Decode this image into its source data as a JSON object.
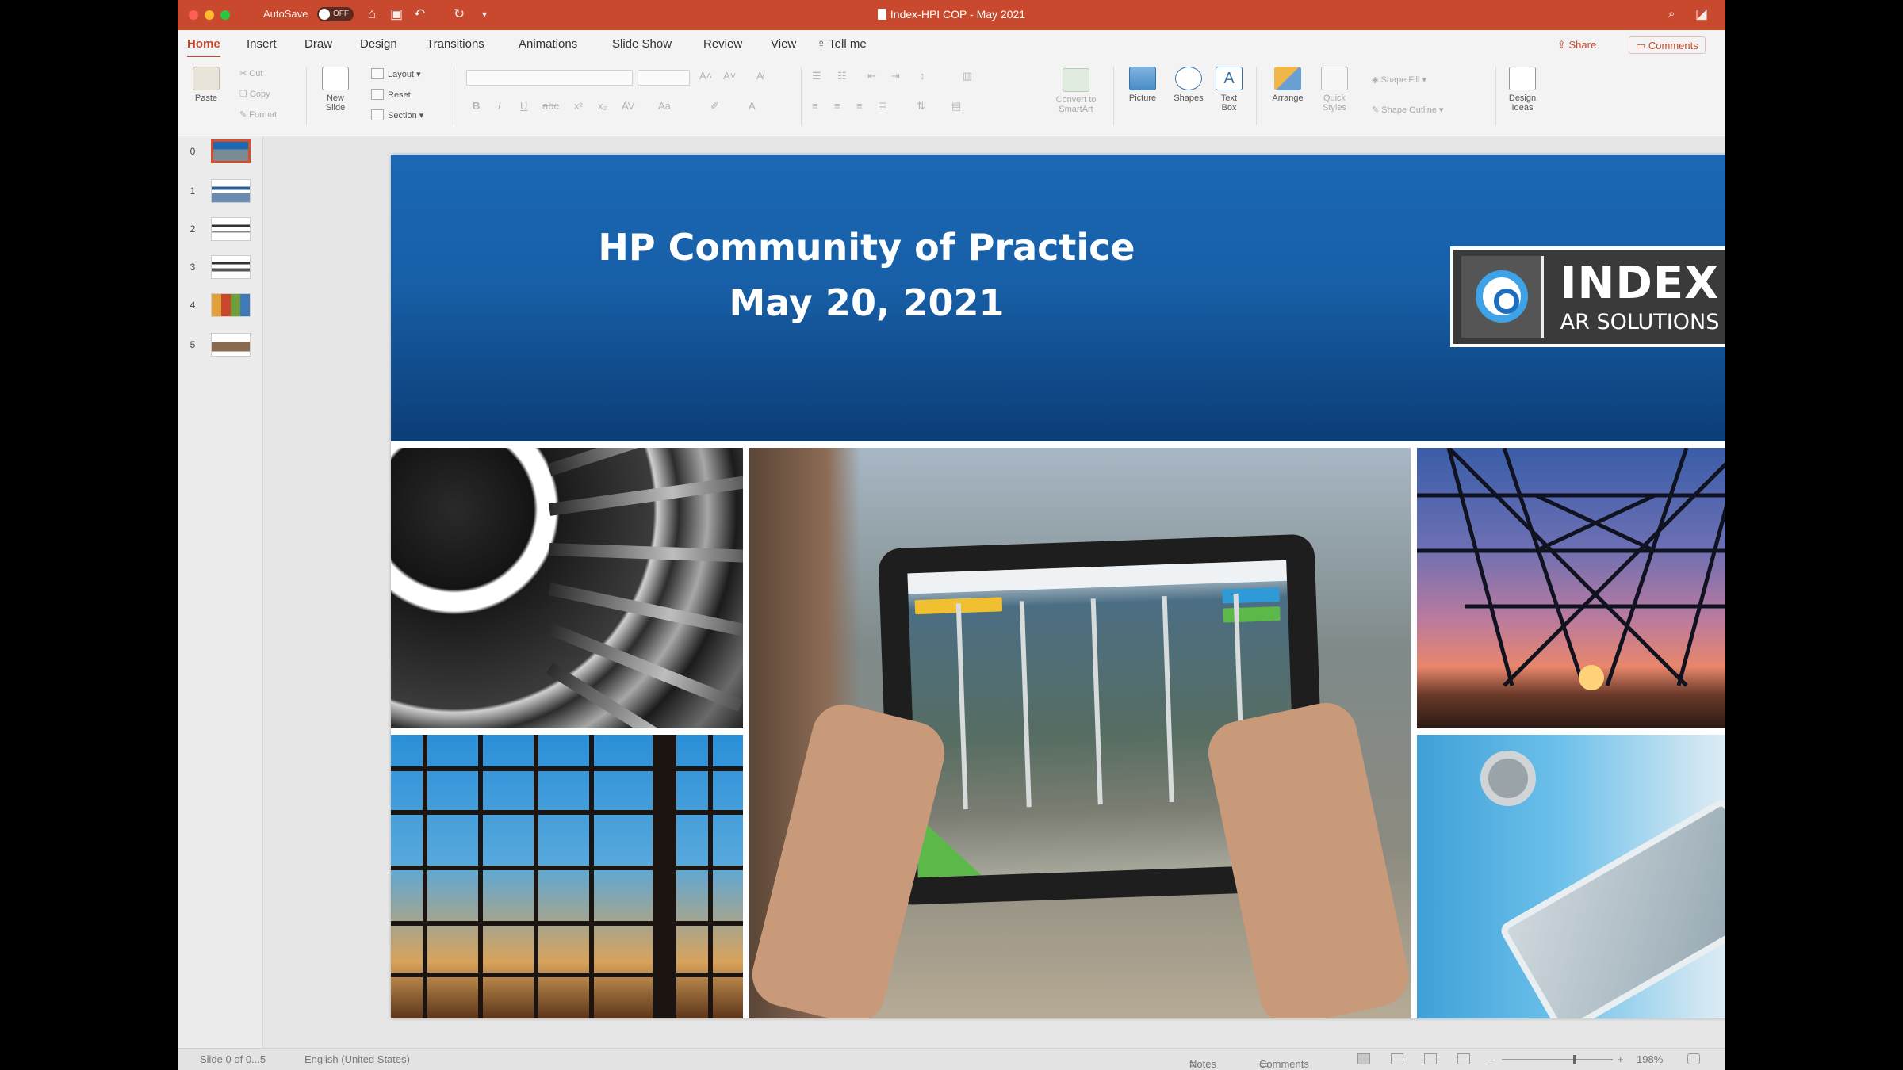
{
  "titlebar": {
    "autosave_label": "AutoSave",
    "autosave_state": "OFF",
    "document_title": "Index-HPI COP - May 2021"
  },
  "tabs": [
    "Home",
    "Insert",
    "Draw",
    "Design",
    "Transitions",
    "Animations",
    "Slide Show",
    "Review",
    "View"
  ],
  "tell_me": "Tell me",
  "share_label": "Share",
  "comments_label": "Comments",
  "ribbon": {
    "paste": "Paste",
    "cut": "Cut",
    "copy": "Copy",
    "format": "Format",
    "new_slide": [
      "New",
      "Slide"
    ],
    "layout": "Layout",
    "reset": "Reset",
    "section": "Section",
    "convert_smartart": [
      "Convert to",
      "SmartArt"
    ],
    "picture": "Picture",
    "shapes": "Shapes",
    "text_box": [
      "Text",
      "Box"
    ],
    "arrange": "Arrange",
    "quick_styles": [
      "Quick",
      "Styles"
    ],
    "shape_fill": "Shape Fill",
    "shape_outline": "Shape Outline",
    "design_ideas": [
      "Design",
      "Ideas"
    ]
  },
  "thumbnails": [
    {
      "num": "0",
      "selected": true
    },
    {
      "num": "1",
      "selected": false
    },
    {
      "num": "2",
      "selected": false
    },
    {
      "num": "3",
      "selected": false
    },
    {
      "num": "4",
      "selected": false
    },
    {
      "num": "5",
      "selected": false
    }
  ],
  "slide": {
    "title_line1": "HP Community of Practice",
    "title_line2": "May 20, 2021",
    "logo_main": "INDEX",
    "logo_sub": "AR SOLUTIONS"
  },
  "statusbar": {
    "slide_info": "Slide 0 of 0...5",
    "language": "English (United States)",
    "notes": "Notes",
    "comments": "Comments",
    "zoom": "198%",
    "zoom_level": 0.66
  },
  "colors": {
    "accent": "#c8492d",
    "banner_blue": "#1a64b0"
  }
}
